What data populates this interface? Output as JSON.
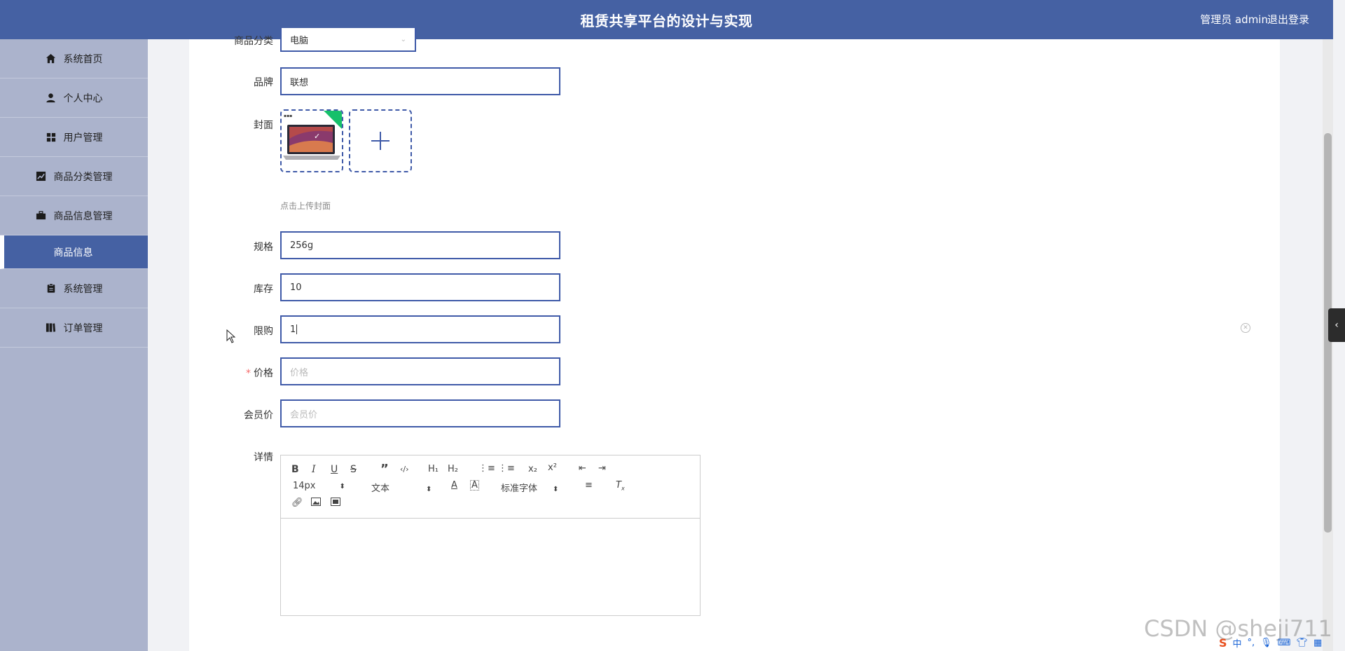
{
  "header": {
    "title": "租赁共享平台的设计与实现",
    "user": "管理员 admin",
    "logout": "退出登录",
    "bg_color": "#4561a3"
  },
  "sidebar": {
    "items": [
      {
        "label": "系统首页",
        "icon": "home-icon"
      },
      {
        "label": "个人中心",
        "icon": "user-icon"
      },
      {
        "label": "用户管理",
        "icon": "grid-icon"
      },
      {
        "label": "商品分类管理",
        "icon": "chart-icon"
      },
      {
        "label": "商品信息管理",
        "icon": "briefcase-icon"
      },
      {
        "label": "商品信息",
        "icon": "",
        "active": true
      },
      {
        "label": "系统管理",
        "icon": "clipboard-icon"
      },
      {
        "label": "订单管理",
        "icon": "book-icon"
      }
    ]
  },
  "form": {
    "category": {
      "label": "商品分类",
      "value": "电脑"
    },
    "brand": {
      "label": "品牌",
      "value": "联想"
    },
    "cover": {
      "label": "封面",
      "hint": "点击上传封面"
    },
    "spec": {
      "label": "规格",
      "value": "256g"
    },
    "stock": {
      "label": "库存",
      "value": "10"
    },
    "limit": {
      "label": "限购",
      "value": "1"
    },
    "price": {
      "label": "价格",
      "placeholder": "价格",
      "required": true
    },
    "member_price": {
      "label": "会员价",
      "placeholder": "会员价"
    },
    "detail": {
      "label": "详情"
    }
  },
  "editor": {
    "font_size": "14px",
    "header_select": "文本",
    "font_family": "标准字体"
  },
  "watermark": "CSDN @sheji711",
  "ime": "中"
}
